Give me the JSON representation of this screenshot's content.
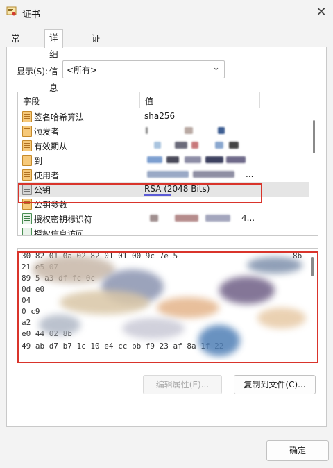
{
  "window": {
    "title": "证书",
    "close_glyph": "✕"
  },
  "tabs": [
    {
      "label": "常规",
      "active": false
    },
    {
      "label": "详细信息",
      "active": true
    },
    {
      "label": "证书路径",
      "active": false
    }
  ],
  "show": {
    "label": "显示(S):",
    "selected": "<所有>"
  },
  "list": {
    "header_field": "字段",
    "header_value": "值",
    "rows": [
      {
        "name": "签名哈希算法",
        "value": "sha256"
      },
      {
        "name": "颁发者",
        "value": ""
      },
      {
        "name": "有效期从",
        "value": ""
      },
      {
        "name": "到",
        "value": ""
      },
      {
        "name": "使用者",
        "value": "..."
      },
      {
        "name": "公钥",
        "value": "RSA (2048 Bits)"
      },
      {
        "name": "公钥参数",
        "value": ""
      },
      {
        "name": "授权密钥标识符",
        "value": "4..."
      },
      {
        "name": "授权信息访问",
        "value": ""
      }
    ]
  },
  "hex": {
    "lines": [
      "30 82 01 0a 02 82 01 01 00 9c 7e 5",
      "                  21 e5 07",
      "89             5 a3 df fc 0c",
      "               0d e0",
      "04",
      "0                                      c9",
      "a2",
      "e0 44                                    02 8b",
      "49 ab d7 b7        1c 10 e4 cc     bb f9 23 af 8a 1f 22"
    ],
    "visible_right": [
      "8b",
      "d4 9b 8b"
    ]
  },
  "buttons": {
    "edit": "编辑属性(E)...",
    "copy": "复制到文件(C)...",
    "ok": "确定"
  },
  "colors": {
    "highlight_box": "#d9342b",
    "selected_row": "#e5e5e5"
  }
}
